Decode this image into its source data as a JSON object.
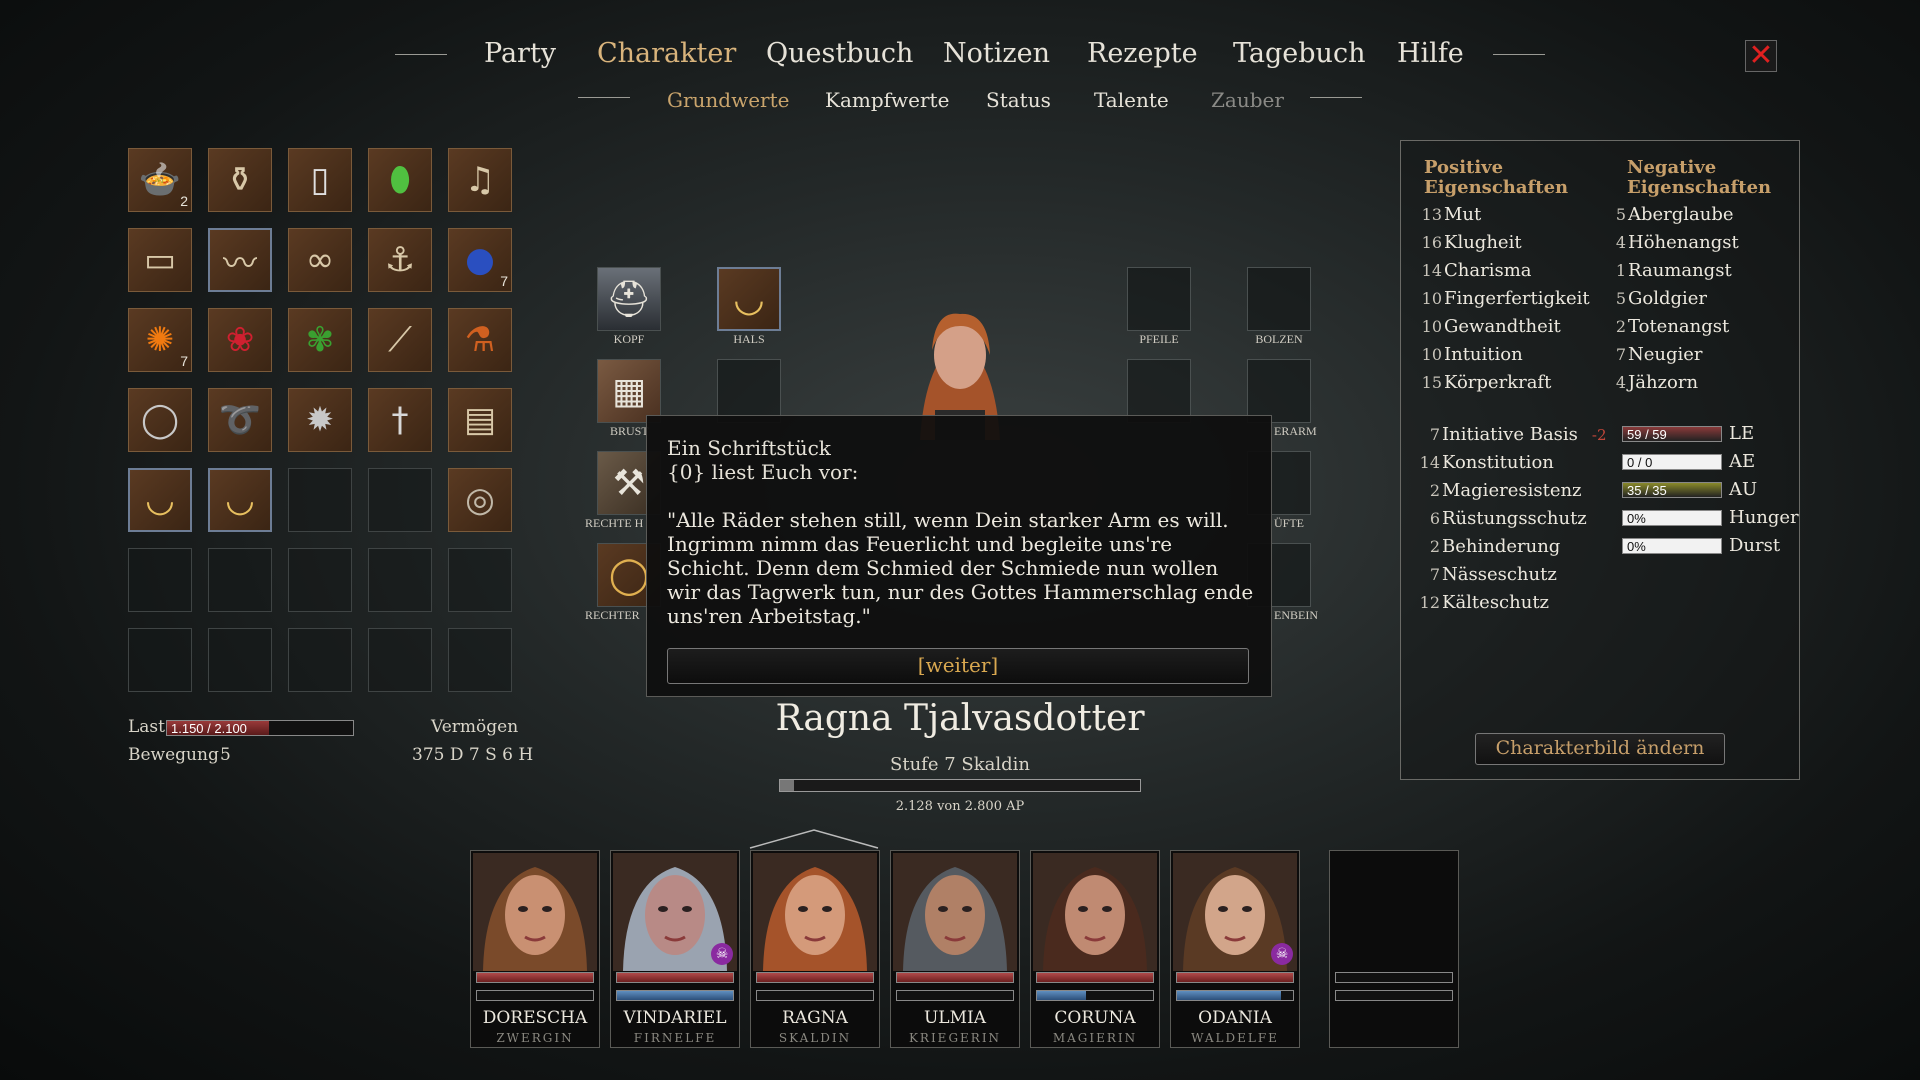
{
  "nav": {
    "tabs": [
      "Party",
      "Charakter",
      "Questbuch",
      "Notizen",
      "Rezepte",
      "Tagebuch",
      "Hilfe"
    ],
    "active": "Charakter",
    "close_icon": "close-x-icon"
  },
  "subnav": {
    "tabs": [
      "Grundwerte",
      "Kampfwerte",
      "Status",
      "Talente",
      "Zauber"
    ],
    "active": "Grundwerte",
    "disabled": "Zauber"
  },
  "inventory": {
    "slots": [
      {
        "icon": "meal-bowl-icon",
        "count": "2"
      },
      {
        "icon": "waterskin-icon",
        "count": ""
      },
      {
        "icon": "flask-icon",
        "count": ""
      },
      {
        "icon": "green-bottle-icon",
        "count": ""
      },
      {
        "icon": "lute-icon",
        "count": ""
      },
      {
        "icon": "bedroll-icon",
        "count": ""
      },
      {
        "icon": "belt-icon",
        "count": ""
      },
      {
        "icon": "shackles-icon",
        "count": ""
      },
      {
        "icon": "grappling-hook-icon",
        "count": ""
      },
      {
        "icon": "blue-berry-icon",
        "count": "7"
      },
      {
        "icon": "orange-flower-icon",
        "count": "7"
      },
      {
        "icon": "red-rose-icon",
        "count": ""
      },
      {
        "icon": "green-herb-icon",
        "count": ""
      },
      {
        "icon": "shovel-icon",
        "count": ""
      },
      {
        "icon": "potion-icon",
        "count": ""
      },
      {
        "icon": "plate-icon",
        "count": ""
      },
      {
        "icon": "rope-icon",
        "count": ""
      },
      {
        "icon": "morningstar-icon",
        "count": ""
      },
      {
        "icon": "dagger-icon",
        "count": ""
      },
      {
        "icon": "scroll-icon",
        "count": ""
      },
      {
        "icon": "amulet-icon",
        "count": ""
      },
      {
        "icon": "amulet-icon",
        "count": ""
      },
      {
        "icon": "",
        "count": ""
      },
      {
        "icon": "",
        "count": ""
      },
      {
        "icon": "round-shield-icon",
        "count": ""
      }
    ],
    "last_label": "Last",
    "last_value": "1.150 / 2.100",
    "last_fraction": 0.548,
    "bewegung_label": "Bewegung",
    "bewegung_value": "5",
    "vermoegen_label": "Vermögen",
    "vermoegen_value": "375 D 7 S 6 H"
  },
  "equipment": {
    "kopf": "KOPF",
    "hals": "HALS",
    "brust": "BRUST",
    "rechte_hand": "RECHTE H",
    "rechter": "RECHTER",
    "pfeile": "PFEILE",
    "bolzen": "BOLZEN",
    "erarm": "ERARM",
    "hufte": "ÜFTE",
    "enbein": "ENBEIN"
  },
  "dialog": {
    "title": "Ein Schriftstück",
    "subtitle": "{0} liest Euch vor:",
    "body": "\"Alle Räder stehen still, wenn Dein starker Arm es will. Ingrimm nimm das Feuerlicht und begleite uns're Schicht. Denn dem Schmied der Schmiede nun wollen wir das Tagwerk tun, nur des Gottes Hammerschlag ende uns'ren Arbeitstag.\"",
    "button": "[weiter]"
  },
  "character": {
    "name": "Ragna Tjalvasdotter",
    "stufe": "Stufe 7 Skaldin",
    "ap_text": "2.128 von 2.800 AP",
    "ap_fraction": 0.04
  },
  "attributes": {
    "positive_header": "Positive Eigenschaften",
    "negative_header": "Negative Eigenschaften",
    "positive": [
      {
        "v": "13",
        "n": "Mut"
      },
      {
        "v": "16",
        "n": "Klugheit"
      },
      {
        "v": "14",
        "n": "Charisma"
      },
      {
        "v": "10",
        "n": "Fingerfertigkeit"
      },
      {
        "v": "10",
        "n": "Gewandtheit"
      },
      {
        "v": "10",
        "n": "Intuition"
      },
      {
        "v": "15",
        "n": "Körperkraft"
      }
    ],
    "negative": [
      {
        "v": "5",
        "n": "Aberglaube"
      },
      {
        "v": "4",
        "n": "Höhenangst"
      },
      {
        "v": "1",
        "n": "Raumangst"
      },
      {
        "v": "5",
        "n": "Goldgier"
      },
      {
        "v": "2",
        "n": "Totenangst"
      },
      {
        "v": "7",
        "n": "Neugier"
      },
      {
        "v": "4",
        "n": "Jähzorn"
      }
    ],
    "derived": [
      {
        "v": "7",
        "n": "Initiative Basis",
        "mod": "-2"
      },
      {
        "v": "14",
        "n": "Konstitution"
      },
      {
        "v": "2",
        "n": "Magieresistenz"
      },
      {
        "v": "6",
        "n": "Rüstungsschutz"
      },
      {
        "v": "2",
        "n": "Behinderung"
      },
      {
        "v": "7",
        "n": "Nässeschutz"
      },
      {
        "v": "12",
        "n": "Kälteschutz"
      }
    ],
    "bars": [
      {
        "text": "59 / 59",
        "label": "LE",
        "fraction": 1.0,
        "color": "#8a3a3a"
      },
      {
        "text": "0 / 0",
        "label": "AE",
        "fraction": 0.0,
        "color": "#3a5a8a"
      },
      {
        "text": "35 / 35",
        "label": "AU",
        "fraction": 1.0,
        "color": "#8a8a2a"
      },
      {
        "text": "0%",
        "label": "Hunger",
        "fraction": 0.0,
        "color": "#555"
      },
      {
        "text": "0%",
        "label": "Durst",
        "fraction": 0.0,
        "color": "#555"
      }
    ],
    "change_portrait": "Charakterbild ändern"
  },
  "party": [
    {
      "name": "DORESCHA",
      "race": "ZWERGIN",
      "hp": 1.0,
      "mp": 0.0,
      "skull": false,
      "skin": "#c99072",
      "hair": "#7a4a2a"
    },
    {
      "name": "VINDARIEL",
      "race": "FIRNELFE",
      "hp": 1.0,
      "mp": 1.0,
      "skull": true,
      "skin": "#b88a86",
      "hair": "#9aa3b0"
    },
    {
      "name": "RAGNA",
      "race": "SKALDIN",
      "hp": 1.0,
      "mp": 0.0,
      "skull": false,
      "skin": "#d49a7a",
      "hair": "#a5532a"
    },
    {
      "name": "ULMIA",
      "race": "KRIEGERIN",
      "hp": 1.0,
      "mp": 0.0,
      "skull": false,
      "skin": "#b08066",
      "hair": "#555a60"
    },
    {
      "name": "CORUNA",
      "race": "MAGIERIN",
      "hp": 1.0,
      "mp": 0.42,
      "skull": false,
      "skin": "#c08a72",
      "hair": "#4a2a1e"
    },
    {
      "name": "ODANIA",
      "race": "WALDELFE",
      "hp": 1.0,
      "mp": 0.9,
      "skull": true,
      "skin": "#d2a58a",
      "hair": "#5a3a24"
    }
  ]
}
